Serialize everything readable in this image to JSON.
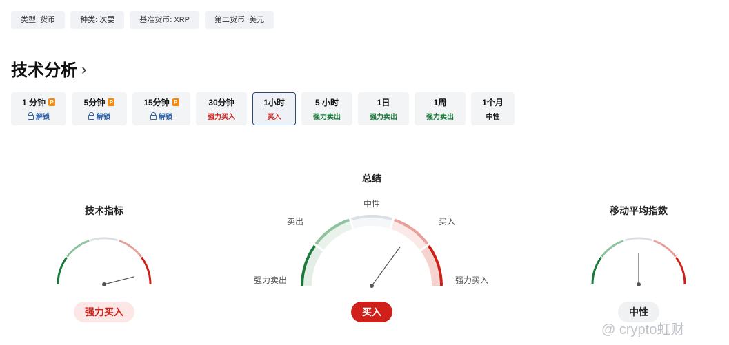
{
  "tags": [
    "类型: 货币",
    "种类: 次要",
    "基准货币: XRP",
    "第二货币: 美元"
  ],
  "section_title": "技术分析",
  "timeframes": [
    {
      "label": "1 分钟",
      "sub": "解锁",
      "pro": true
    },
    {
      "label": "5分钟",
      "sub": "解锁",
      "pro": true
    },
    {
      "label": "15分钟",
      "sub": "解锁",
      "pro": true
    },
    {
      "label": "30分钟",
      "sub": "强力买入",
      "pro": false
    },
    {
      "label": "1小时",
      "sub": "买入",
      "pro": false,
      "active": true
    },
    {
      "label": "5 小时",
      "sub": "强力卖出",
      "pro": false
    },
    {
      "label": "1日",
      "sub": "强力卖出",
      "pro": false
    },
    {
      "label": "1周",
      "sub": "强力卖出",
      "pro": false
    },
    {
      "label": "1个月",
      "sub": "中性",
      "pro": false
    }
  ],
  "pro_badge": "P",
  "gauges": {
    "indicators": {
      "title": "技术指标",
      "result": "强力买入",
      "level": 0.92
    },
    "summary": {
      "title": "总结",
      "result": "买入",
      "level": 0.7,
      "labels": {
        "strong_sell": "强力卖出",
        "sell": "卖出",
        "neutral": "中性",
        "buy": "买入",
        "strong_buy": "强力买入"
      }
    },
    "moving_averages": {
      "title": "移动平均指数",
      "result": "中性",
      "level": 0.5
    }
  },
  "watermark": "@ crypto虹财",
  "colors": {
    "strong_buy": "#d0201a",
    "buy": "#e8a09a",
    "neutral": "#dcdfe3",
    "sell": "#8fc29f",
    "strong_sell": "#1a7a3a",
    "active_border": "#2a4a80",
    "pro_badge": "#f08a12"
  }
}
